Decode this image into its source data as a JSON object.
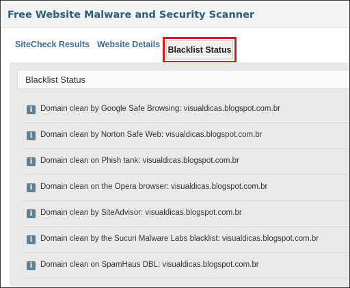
{
  "header": {
    "title": "Free Website Malware and Security Scanner"
  },
  "tabs": [
    {
      "label": "SiteCheck Results"
    },
    {
      "label": "Website Details"
    },
    {
      "label": "Blacklist Status"
    }
  ],
  "panel": {
    "title": "Blacklist Status"
  },
  "items": [
    {
      "icon": "info-icon",
      "text": "Domain clean by Google Safe Browsing: visualdicas.blogspot.com.br"
    },
    {
      "icon": "info-icon",
      "text": "Domain clean by Norton Safe Web: visualdicas.blogspot.com.br"
    },
    {
      "icon": "info-icon",
      "text": "Domain clean on Phish tank: visualdicas.blogspot.com.br"
    },
    {
      "icon": "info-icon",
      "text": "Domain clean on the Opera browser: visualdicas.blogspot.com.br"
    },
    {
      "icon": "info-icon",
      "text": "Domain clean by SiteAdvisor: visualdicas.blogspot.com.br"
    },
    {
      "icon": "info-icon",
      "text": "Domain clean by the Sucuri Malware Labs blacklist: visualdicas.blogspot.com.br"
    },
    {
      "icon": "info-icon",
      "text": "Domain clean on SpamHaus DBL: visualdicas.blogspot.com.br"
    }
  ],
  "colors": {
    "title": "#2b5f7d",
    "tab_link": "#3a6e8f",
    "highlight_outline": "#e0141c",
    "info_icon": "#5f7f93"
  }
}
